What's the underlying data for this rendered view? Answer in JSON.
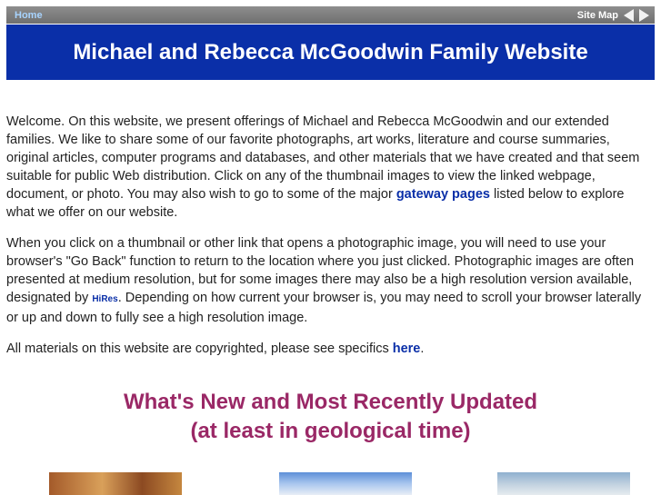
{
  "nav": {
    "home": "Home",
    "sitemap": "Site Map",
    "prev_icon": "triangle-left",
    "next_icon": "triangle-right"
  },
  "banner": {
    "title": "Michael and Rebecca McGoodwin Family Website"
  },
  "intro": {
    "p1_a": "Welcome.  On this website, we present offerings of Michael and Rebecca McGoodwin and our extended families.  We like to share some of our favorite photographs, art works, literature and course summaries, original articles, computer programs and databases, and other materials that we have created and that seem suitable for public Web distribution.  Click on any of the thumbnail images to view the linked webpage, document, or photo.  You may also wish to go to some of the major ",
    "p1_link": "gateway pages",
    "p1_b": " listed below to explore what we offer on our website.",
    "p2_a": "When you click on a thumbnail or other link that opens a photographic image, you will need to use your browser's \"Go Back\" function to return to the location where you just clicked.  Photographic images are often presented at medium resolution, but for some images there may also be a high resolution version available, designated by ",
    "p2_hires": "HiRes",
    "p2_b": ".  Depending on how current your browser is, you may need to scroll your browser laterally or up and down to fully see a high resolution image.",
    "p3_a": "All materials on this website are copyrighted, please see specifics ",
    "p3_link": "here",
    "p3_b": "."
  },
  "section": {
    "line1": "What's New and Most Recently Updated",
    "line2": "(at least in geological time)"
  },
  "colors": {
    "banner": "#0a2fa8",
    "link": "#0a2fa8",
    "section_title": "#9a2866"
  }
}
